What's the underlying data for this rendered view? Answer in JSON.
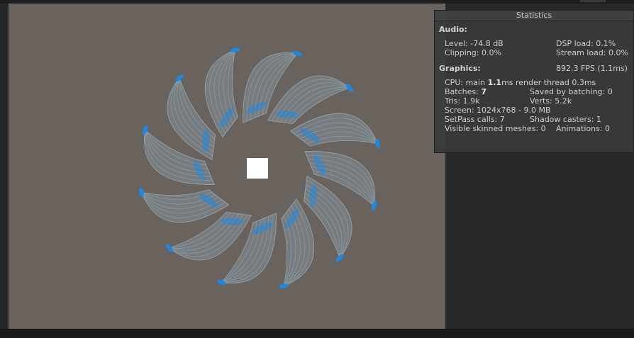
{
  "stats": {
    "title": "Statistics",
    "audio": {
      "heading": "Audio:",
      "level": "Level: -74.8 dB",
      "dsp_load": "DSP load: 0.1%",
      "clipping": "Clipping: 0.0%",
      "stream_load": "Stream load: 0.0%"
    },
    "graphics": {
      "heading": "Graphics:",
      "fps": "892.3 FPS (1.1ms)",
      "cpu_prefix": "CPU: main ",
      "cpu_main_value": "1.1",
      "cpu_suffix": "ms  render thread 0.3ms",
      "batches_prefix": "Batches: ",
      "batches_value": "7",
      "saved_by_batching": "Saved by batching: 0",
      "tris": "Tris: 1.9k",
      "verts": "Verts: 5.2k",
      "screen": "Screen: 1024x768 - 9.0 MB",
      "setpass": "SetPass calls: 7",
      "shadow_casters": "Shadow casters: 1",
      "visible_skinned": "Visible skinned meshes: 0",
      "animations": "Animations: 0"
    }
  },
  "scene": {
    "background_color": "#6a625d",
    "particle_color": "#1e88e5",
    "trail_color": "#9ec3d6",
    "center_object_color": "#ffffff",
    "blade_count": 12
  }
}
